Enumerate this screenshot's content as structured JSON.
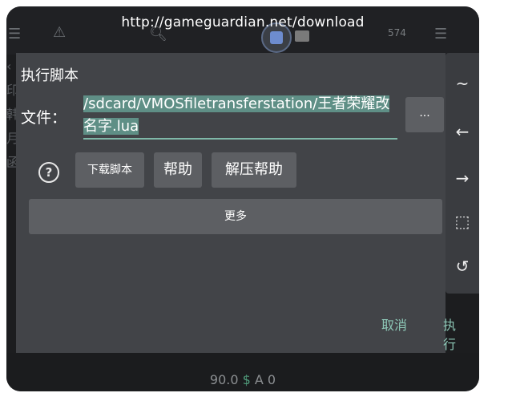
{
  "topbar": {
    "url": "http://gameguardian.net/download",
    "count": "574"
  },
  "dialog": {
    "title": "执行脚本",
    "file_label": "文件：",
    "file_path": "/sdcard/VMOSfiletransferstation/王者荣耀改名字.lua",
    "browse_label": "...",
    "buttons": {
      "download_script": "下载脚本",
      "help": "帮助",
      "unzip_help": "解压帮助",
      "more": "更多"
    },
    "actions": {
      "cancel": "取消",
      "run": "执行"
    }
  },
  "sidepanel": {
    "icons": [
      "tilde-icon",
      "arrow-left-icon",
      "arrow-right-icon",
      "select-area-icon",
      "history-icon"
    ]
  },
  "bottombar": {
    "value": "90.0",
    "currency": "$",
    "suffix": "A 0"
  }
}
